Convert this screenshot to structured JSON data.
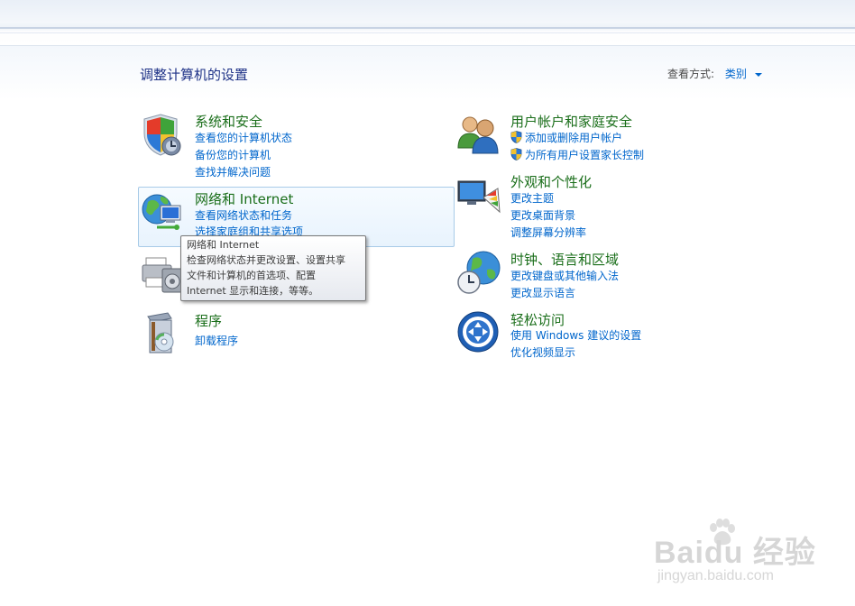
{
  "page_title": "调整计算机的设置",
  "view_by": {
    "label": "查看方式:",
    "value": "类别"
  },
  "categories": [
    {
      "title": "系统和安全",
      "links": [
        "查看您的计算机状态",
        "备份您的计算机",
        "查找并解决问题"
      ],
      "icon": "security-shield-icon"
    },
    {
      "title": "网络和 Internet",
      "links": [
        "查看网络状态和任务",
        "选择家庭组和共享选项"
      ],
      "icon": "network-globe-icon"
    },
    {
      "title": "",
      "links": [],
      "icon": "printer-hardware-icon"
    },
    {
      "title": "程序",
      "links": [
        "卸载程序"
      ],
      "icon": "programs-box-icon"
    },
    {
      "title": "用户帐户和家庭安全",
      "links": [
        "添加或删除用户帐户",
        "为所有用户设置家长控制"
      ],
      "icon": "users-icon"
    },
    {
      "title": "外观和个性化",
      "links": [
        "更改主题",
        "更改桌面背景",
        "调整屏幕分辨率"
      ],
      "icon": "appearance-monitor-icon"
    },
    {
      "title": "时钟、语言和区域",
      "links": [
        "更改键盘或其他输入法",
        "更改显示语言"
      ],
      "icon": "clock-globe-icon"
    },
    {
      "title": "轻松访问",
      "links": [
        "使用 Windows 建议的设置",
        "优化视频显示"
      ],
      "icon": "ease-of-access-icon"
    }
  ],
  "tooltip": {
    "lines": [
      "网络和 Internet",
      "检查网络状态并更改设置、设置共享",
      "文件和计算机的首选项、配置",
      "Internet 显示和连接，等等。"
    ]
  },
  "watermark": {
    "brand": "Baidu 经验",
    "url": "jingyan.baidu.com"
  },
  "colors": {
    "title_green": "#1a6e1a",
    "link_blue": "#0066cc",
    "heading_blue": "#1e3287"
  }
}
